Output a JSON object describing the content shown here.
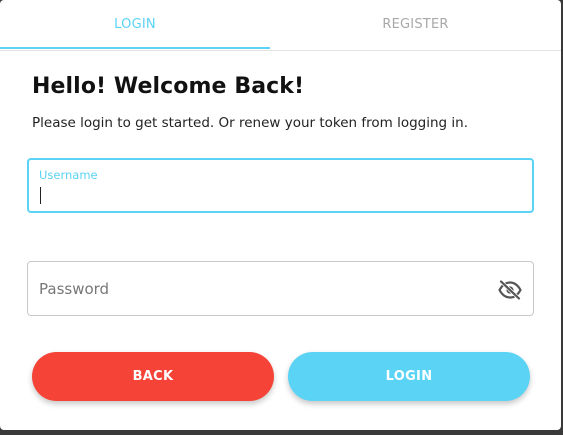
{
  "tabs": [
    {
      "label": "LOGIN",
      "active": true
    },
    {
      "label": "REGISTER",
      "active": false
    }
  ],
  "header": {
    "title": "Hello! Welcome Back!",
    "subtitle": "Please login to get started. Or renew your token from logging in."
  },
  "form": {
    "username": {
      "label": "Username",
      "value": ""
    },
    "password": {
      "placeholder": "Password",
      "value": "",
      "visibility_icon": "eye-off-icon"
    }
  },
  "actions": {
    "back_label": "BACK",
    "login_label": "LOGIN"
  },
  "colors": {
    "accent": "#5ad3f5",
    "danger": "#f54337",
    "tab_inactive": "#a8a8a8"
  }
}
